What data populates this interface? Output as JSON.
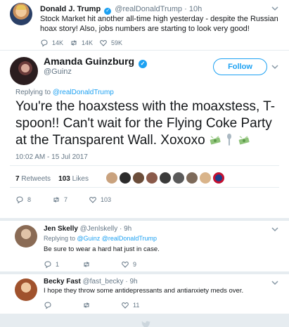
{
  "parent_tweet": {
    "name": "Donald J. Trump",
    "handle": "@realDonaldTrump",
    "time": "10h",
    "text": "Stock Market hit another all-time high yesterday - despite the Russian hoax story! Also, jobs numbers are starting to look very good!",
    "replies": "14K",
    "retweets": "14K",
    "likes": "59K"
  },
  "main_tweet": {
    "name": "Amanda Guinzburg",
    "handle": "@Guinz",
    "follow_label": "Follow",
    "replying_prefix": "Replying to",
    "replying_to": "@realDonaldTrump",
    "text": "You're the hoaxstess with the moaxstess, T-spoon!! Can't wait for the Flying Coke Party at the Transparent Wall. Xoxoxo",
    "timestamp": "10:02 AM - 15 Jul 2017",
    "retweet_count": "7",
    "retweet_label": "Retweets",
    "like_count": "103",
    "like_label": "Likes",
    "reply_count": "8",
    "retweets": "7",
    "likes": "103"
  },
  "replies": [
    {
      "name": "Jen Skelly",
      "handle": "@Jenlskelly",
      "time": "9h",
      "replying_prefix": "Replying to",
      "replying_to": "@Guinz @realDonaldTrump",
      "text": "Be sure to wear a hard hat just in case.",
      "reply_count": "1",
      "retweet_count": "",
      "like_count": "9"
    },
    {
      "name": "Becky Fast",
      "handle": "@fast_becky",
      "time": "9h",
      "text": "I hope they throw some antidepressants and antianxiety meds over.",
      "reply_count": "",
      "retweet_count": "",
      "like_count": "11"
    }
  ],
  "colors": {
    "accent": "#1da1f2",
    "muted": "#657786",
    "background": "#e6ecf0"
  },
  "icons": [
    "verified-badge-icon",
    "chevron-down-icon",
    "reply-icon",
    "retweet-icon",
    "like-icon",
    "money-emoji-icon",
    "spoon-emoji-icon",
    "twitter-bird-icon"
  ]
}
